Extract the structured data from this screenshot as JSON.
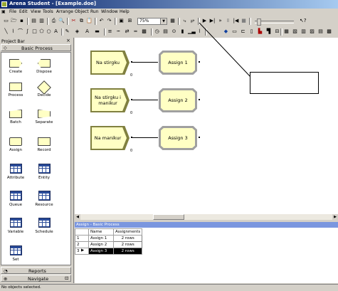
{
  "window": {
    "title": "Arena Student - [Example.doe]"
  },
  "menu": [
    "File",
    "Edit",
    "View",
    "Tools",
    "Arrange",
    "Object",
    "Run",
    "Window",
    "Help"
  ],
  "toolbar": {
    "zoom": "75%"
  },
  "project_bar": {
    "header": "Project Bar",
    "panel_title": "Basic Process",
    "modules": [
      {
        "label": "Create",
        "shape": "create"
      },
      {
        "label": "Dispose",
        "shape": "dispose"
      },
      {
        "label": "Process",
        "shape": "process"
      },
      {
        "label": "Decide",
        "shape": "decide"
      },
      {
        "label": "Batch",
        "shape": "batch"
      },
      {
        "label": "Separate",
        "shape": "separate"
      },
      {
        "label": "Assign",
        "shape": "assign"
      },
      {
        "label": "Record",
        "shape": "record"
      },
      {
        "label": "Attribute",
        "shape": "table"
      },
      {
        "label": "Entity",
        "shape": "table"
      },
      {
        "label": "Queue",
        "shape": "table"
      },
      {
        "label": "Resource",
        "shape": "table"
      },
      {
        "label": "Variable",
        "shape": "table"
      },
      {
        "label": "Schedule",
        "shape": "table"
      },
      {
        "label": "Set",
        "shape": "table"
      }
    ],
    "reports": "Reports",
    "navigate": "Navigate"
  },
  "flowchart": {
    "creates": [
      "Na stirgku",
      "Na stirgku i manikur",
      "Na manikur"
    ],
    "assigns": [
      "Assign 1",
      "Assign 2",
      "Assign 3"
    ]
  },
  "spreadsheet": {
    "title": "Assign - Basic Process",
    "columns": [
      "Name",
      "Assignments"
    ],
    "rows": [
      {
        "num": "1",
        "name": "Assign 1",
        "assignments": "2 rows"
      },
      {
        "num": "2",
        "name": "Assign 2",
        "assignments": "2 rows"
      },
      {
        "num": "3",
        "name": "Assign 3",
        "assignments": "2 rows"
      }
    ]
  },
  "status": "No objects selected."
}
